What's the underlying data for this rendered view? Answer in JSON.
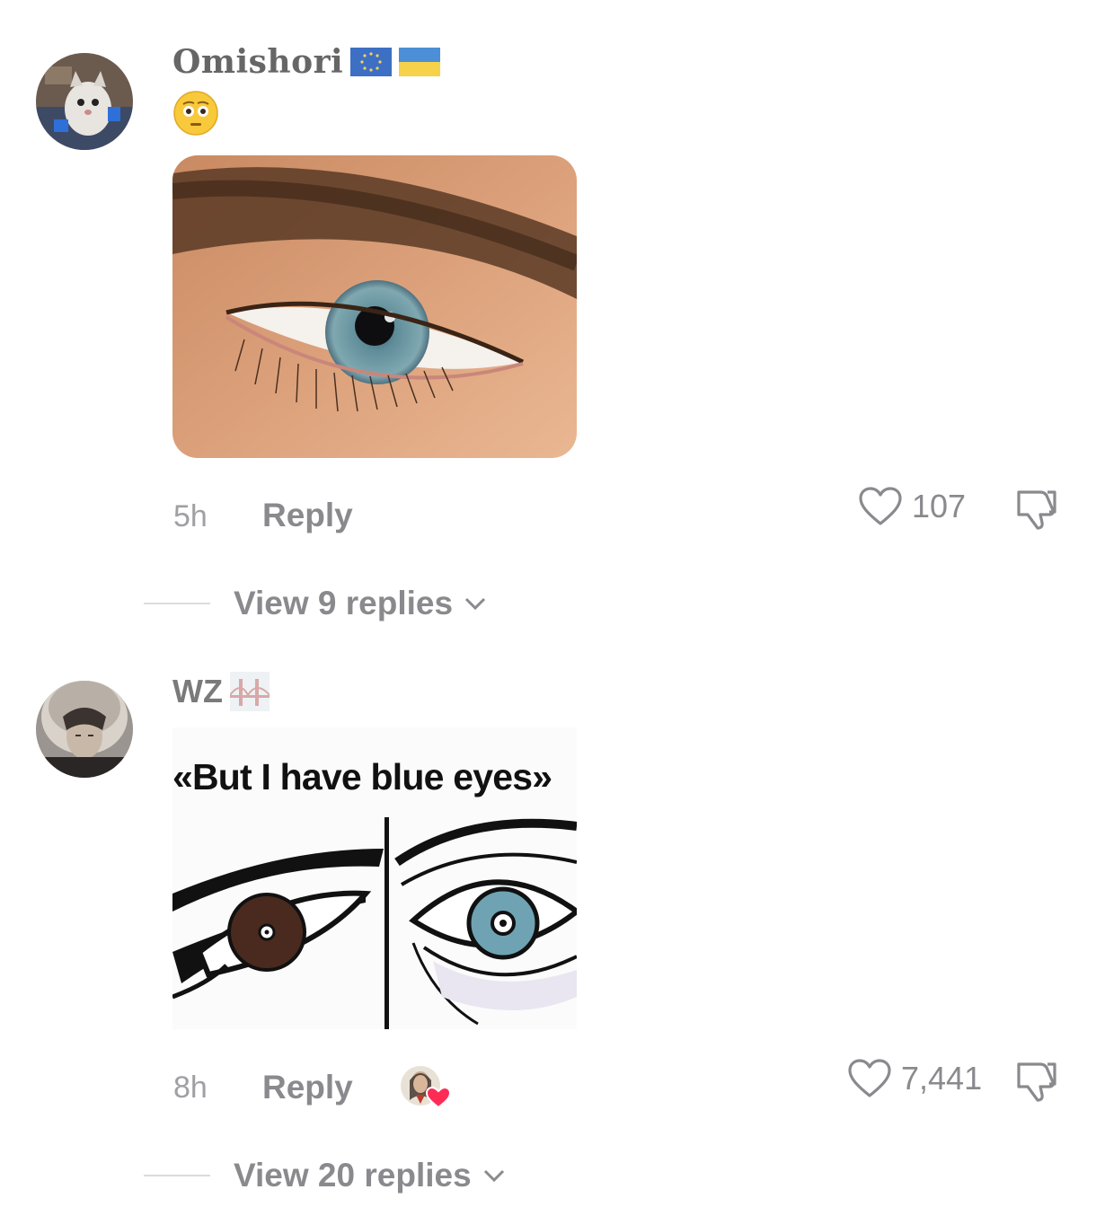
{
  "comments": [
    {
      "username": "Omishori",
      "username_flags": [
        "eu-flag-icon",
        "ukraine-flag-icon"
      ],
      "text_emoji": "😳",
      "attached_image": "eye-photo",
      "time": "5h",
      "reply_label": "Reply",
      "like_count": "107",
      "view_replies_label": "View 9 replies"
    },
    {
      "username": "WZ",
      "username_badge": "bridge-sticker-icon",
      "attached_image": "eyes-meme",
      "meme_caption": "«But I have blue eyes»",
      "time": "8h",
      "reply_label": "Reply",
      "creator_liked": true,
      "like_count": "7,441",
      "view_replies_label": "View 20 replies"
    }
  ],
  "colors": {
    "meta_gray": "#a0a0a4",
    "action_gray": "#8a8a8e",
    "heart_red": "#fe2c55",
    "eye_blue": "#6fa3b3",
    "eye_brown": "#4a2a1e"
  }
}
